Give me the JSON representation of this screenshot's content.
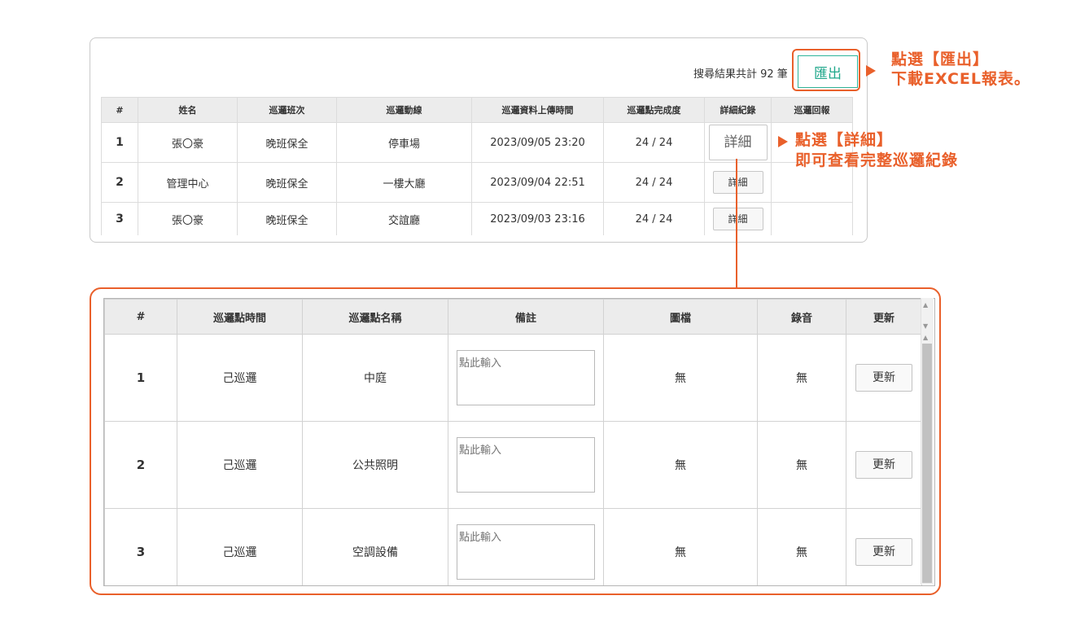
{
  "top": {
    "result_count": "搜尋結果共計 92 筆",
    "export_label": "匯出",
    "headers": [
      "#",
      "姓名",
      "巡邏班次",
      "巡邏動線",
      "巡邏資料上傳時間",
      "巡邏點完成度",
      "詳細紀錄",
      "巡邏回報"
    ],
    "rows": [
      {
        "num": "1",
        "name": "張〇豪",
        "shift": "晚班保全",
        "route": "停車場",
        "time": "2023/09/05 23:20",
        "progress": "24 / 24",
        "detail": "詳細"
      },
      {
        "num": "2",
        "name": "管理中心",
        "shift": "晚班保全",
        "route": "一樓大廳",
        "time": "2023/09/04 22:51",
        "progress": "24 / 24",
        "detail": "詳細"
      },
      {
        "num": "3",
        "name": "張〇豪",
        "shift": "晚班保全",
        "route": "交誼廳",
        "time": "2023/09/03 23:16",
        "progress": "24 / 24",
        "detail": "詳細"
      }
    ]
  },
  "annotations": {
    "export_line1": "點選【匯出】",
    "export_line2": "下載EXCEL報表。",
    "detail_line1": "點選【詳細】",
    "detail_line2": "即可查看完整巡邏紀錄",
    "accent_color": "#e9602b"
  },
  "bottom": {
    "headers": [
      "#",
      "巡邏點時間",
      "巡邏點名稱",
      "備註",
      "圖檔",
      "錄音",
      "更新"
    ],
    "rows": [
      {
        "num": "1",
        "time": "己巡邏",
        "name": "中庭",
        "note_placeholder": "點此輸入",
        "image": "無",
        "audio": "無",
        "update": "更新"
      },
      {
        "num": "2",
        "time": "己巡邏",
        "name": "公共照明",
        "note_placeholder": "點此輸入",
        "image": "無",
        "audio": "無",
        "update": "更新"
      },
      {
        "num": "3",
        "time": "己巡邏",
        "name": "空調設備",
        "note_placeholder": "點此輸入",
        "image": "無",
        "audio": "無",
        "update": "更新"
      }
    ]
  }
}
